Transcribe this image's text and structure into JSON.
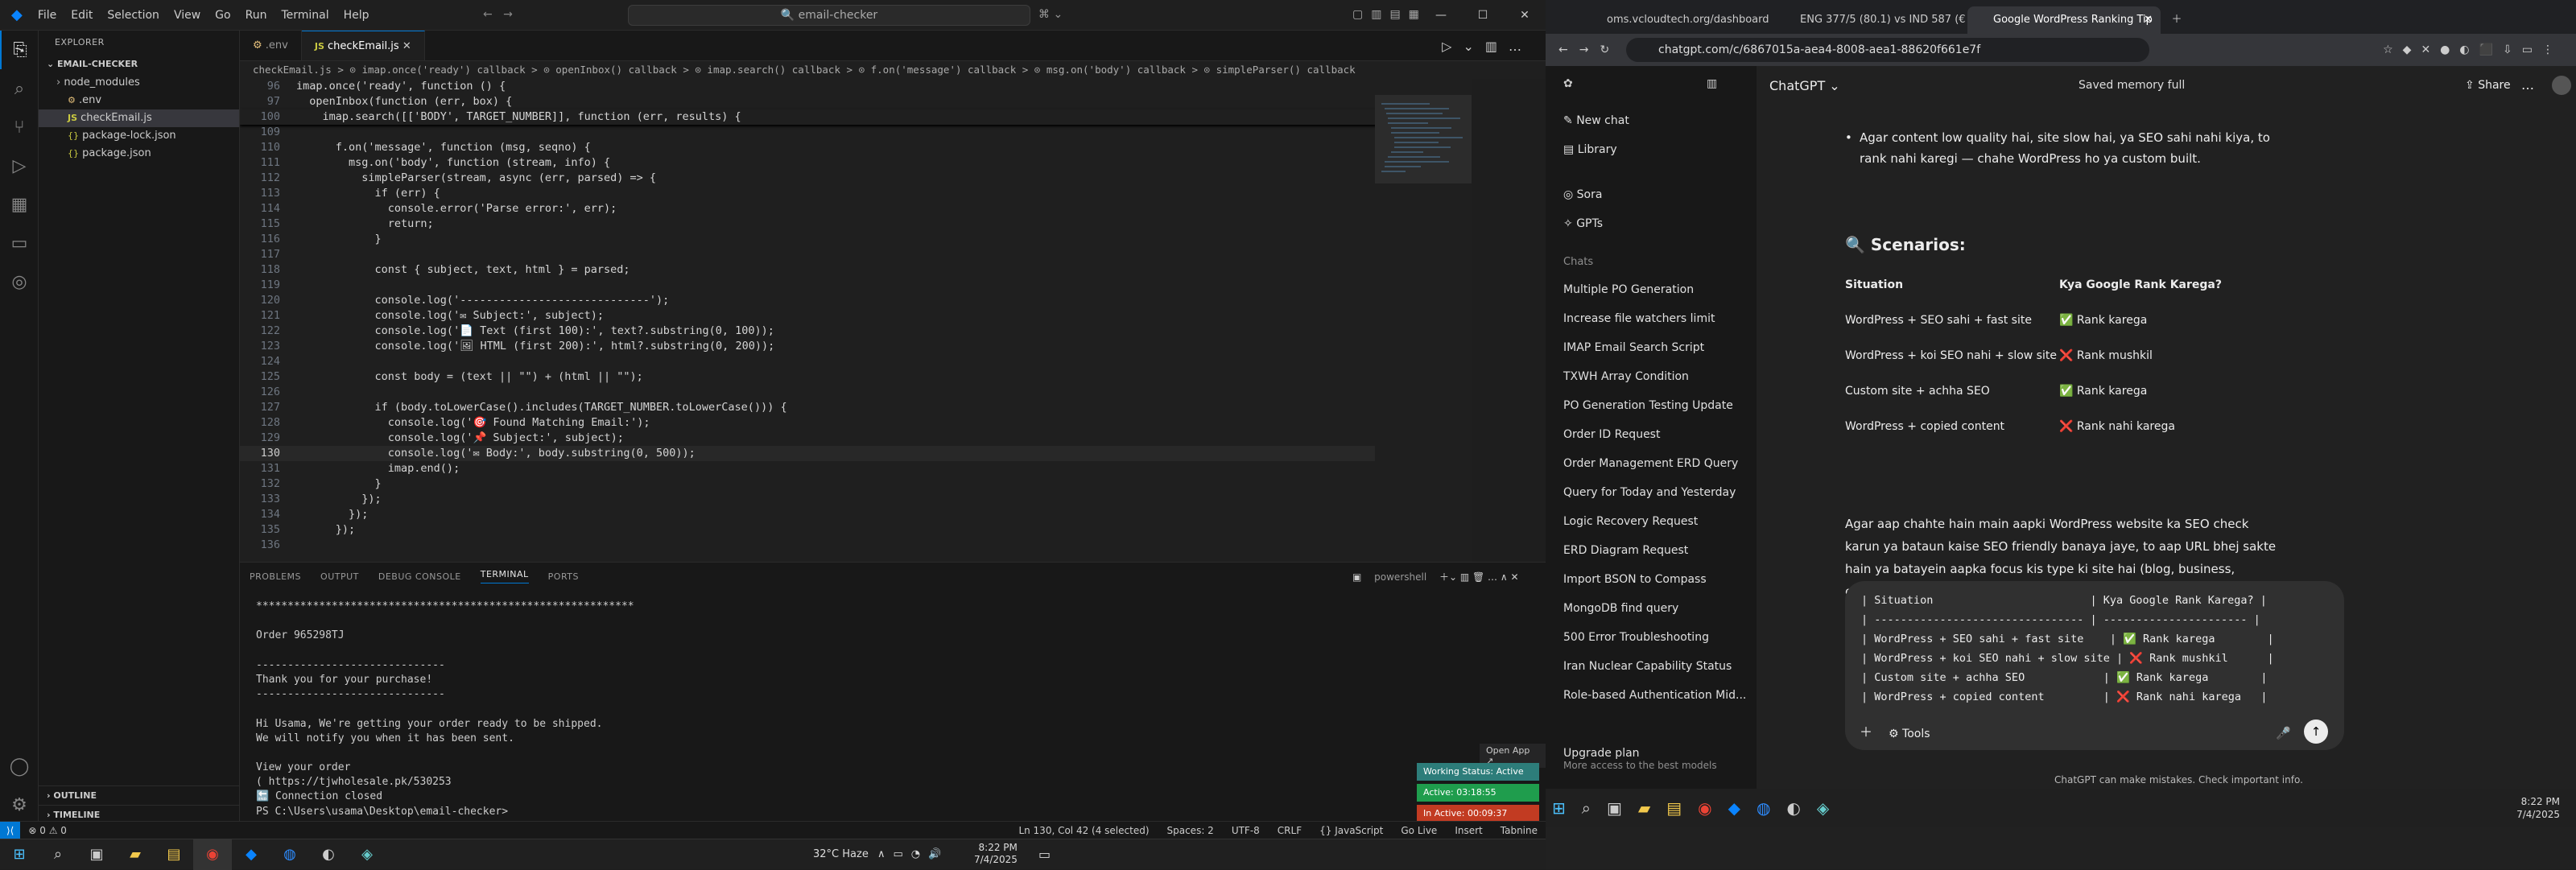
{
  "vscode": {
    "menu": [
      "File",
      "Edit",
      "Selection",
      "View",
      "Go",
      "Run",
      "Terminal",
      "Help"
    ],
    "command_center": "email-checker",
    "tabs": [
      ".env",
      "checkEmail.js"
    ],
    "breadcrumbs": "checkEmail.js > ⊙ imap.once('ready') callback > ⊙ openInbox() callback > ⊙ imap.search() callback > ⊙ f.on('message') callback > ⊙ msg.on('body') callback > ⊙ simpleParser() callback",
    "explorer": {
      "title": "EXPLORER",
      "folder": "EMAIL-CHECKER",
      "items": [
        "node_modules",
        ".env",
        "checkEmail.js",
        "package-lock.json",
        "package.json"
      ],
      "outline": "OUTLINE",
      "timeline": "TIMELINE"
    },
    "sticky_lines": [
      {
        "n": "96",
        "t": "imap.once('ready', function () {"
      },
      {
        "n": "97",
        "t": "  openInbox(function (err, box) {"
      },
      {
        "n": "100",
        "t": "    imap.search([['BODY', TARGET_NUMBER]], function (err, results) {"
      }
    ],
    "code_lines": [
      {
        "n": "109",
        "t": ""
      },
      {
        "n": "110",
        "t": "      f.on('message', function (msg, seqno) {"
      },
      {
        "n": "111",
        "t": "        msg.on('body', function (stream, info) {"
      },
      {
        "n": "112",
        "t": "          simpleParser(stream, async (err, parsed) => {"
      },
      {
        "n": "113",
        "t": "            if (err) {"
      },
      {
        "n": "114",
        "t": "              console.error('Parse error:', err);"
      },
      {
        "n": "115",
        "t": "              return;"
      },
      {
        "n": "116",
        "t": "            }"
      },
      {
        "n": "117",
        "t": ""
      },
      {
        "n": "118",
        "t": "            const { subject, text, html } = parsed;"
      },
      {
        "n": "119",
        "t": ""
      },
      {
        "n": "120",
        "t": "            console.log('-----------------------------');"
      },
      {
        "n": "121",
        "t": "            console.log('✉ Subject:', subject);"
      },
      {
        "n": "122",
        "t": "            console.log('📄 Text (first 100):', text?.substring(0, 100));"
      },
      {
        "n": "123",
        "t": "            console.log('🖼 HTML (first 200):', html?.substring(0, 200));"
      },
      {
        "n": "124",
        "t": ""
      },
      {
        "n": "125",
        "t": "            const body = (text || \"\") + (html || \"\");"
      },
      {
        "n": "126",
        "t": ""
      },
      {
        "n": "127",
        "t": "            if (body.toLowerCase().includes(TARGET_NUMBER.toLowerCase())) {"
      },
      {
        "n": "128",
        "t": "              console.log('🎯 Found Matching Email:');"
      },
      {
        "n": "129",
        "t": "              console.log('📌 Subject:', subject);"
      },
      {
        "n": "130",
        "t": "              console.log('✉ Body:', body.substring(0, 500));"
      },
      {
        "n": "131",
        "t": "              imap.end();"
      },
      {
        "n": "132",
        "t": "            }"
      },
      {
        "n": "133",
        "t": "          });"
      },
      {
        "n": "134",
        "t": "        });"
      },
      {
        "n": "135",
        "t": "      });"
      },
      {
        "n": "136",
        "t": ""
      }
    ],
    "panel_tabs": [
      "PROBLEMS",
      "OUTPUT",
      "DEBUG CONSOLE",
      "TERMINAL",
      "PORTS"
    ],
    "terminal_name": "powershell",
    "terminal_lines": [
      "************************************************************",
      "",
      "Order 965298TJ",
      "",
      "------------------------------",
      "Thank you for your purchase!",
      "------------------------------",
      "",
      "Hi Usama, We're getting your order ready to be shipped.",
      "We will notify you when it has been sent.",
      "",
      "View your order",
      "( https://tjwholesale.pk/530253",
      "🔚 Connection closed",
      "PS C:\\Users\\usama\\Desktop\\email-checker> "
    ],
    "open_app": "Open App ↗",
    "toasts": [
      "Working Status: Active",
      "Active: 03:18:55",
      "In Active: 00:09:37"
    ],
    "status_left": "⊗ 0 ⚠ 0",
    "status_right": [
      "Ln 130, Col 42 (4 selected)",
      "Spaces: 2",
      "UTF-8",
      "CRLF",
      "{} JavaScript",
      "Go Live",
      "Insert",
      "Tabnine"
    ],
    "weather": "32°C Haze",
    "clock_time": "8:22 PM",
    "clock_date": "7/4/2025"
  },
  "chrome": {
    "tabs": [
      "oms.vcloudtech.org/dashboard",
      "ENG 377/5 (80.1) vs IND 587 (€",
      "Google WordPress Ranking Tip"
    ],
    "url": "chatgpt.com/c/6867015a-aea4-8008-aea1-88620f661e7f",
    "sidebar": {
      "new_chat": "New chat",
      "library": "Library",
      "sora": "Sora",
      "gpts": "GPTs",
      "chats_label": "Chats",
      "chats": [
        "Multiple PO Generation",
        "Increase file watchers limit",
        "IMAP Email Search Script",
        "TXWH Array Condition",
        "PO Generation Testing Update",
        "Order ID Request",
        "Order Management ERD Query",
        "Query for Today and Yesterday",
        "Logic Recovery Request",
        "ERD Diagram Request",
        "Import BSON to Compass",
        "MongoDB find query",
        "500 Error Troubleshooting",
        "Iran Nuclear Capability Status",
        "Role-based Authentication Mid..."
      ],
      "upgrade": "Upgrade plan",
      "upgrade_sub": "More access to the best models"
    },
    "header": {
      "model": "ChatGPT ⌄",
      "memory": "Saved memory full",
      "share": "Share"
    },
    "bullet": "Agar content low quality hai, site slow hai, ya SEO sahi nahi kiya, to rank nahi karegi — chahe WordPress ho ya custom built.",
    "scenarios_title": "🔍 Scenarios:",
    "table_headers": [
      "Situation",
      "Kya Google Rank Karega?"
    ],
    "table_rows": [
      [
        "WordPress + SEO sahi + fast site",
        "✅ Rank karega"
      ],
      [
        "WordPress + koi SEO nahi + slow site",
        "❌ Rank mushkil"
      ],
      [
        "Custom site + achha SEO",
        "✅ Rank karega"
      ],
      [
        "WordPress + copied content",
        "❌ Rank nahi karega"
      ]
    ],
    "para": "Agar aap chahte hain main aapki WordPress website ka SEO check karun ya bataun kaise SEO friendly banaya jaye, to aap URL bhej sakte hain ya batayein aapka focus kis type ki site hai (blog, business, ecommerce etc.).",
    "composer_lines": [
      "| Situation                        | Kya Google Rank Karega? |",
      "| -------------------------------- | ---------------------- |",
      "| WordPress + SEO sahi + fast site    | ✅ Rank karega        |",
      "| WordPress + koi SEO nahi + slow site | ❌ Rank mushkil      |",
      "| Custom site + achha SEO            | ✅ Rank karega        |",
      "| WordPress + copied content         | ❌ Rank nahi karega   |"
    ],
    "tools": "Tools",
    "disclaimer": "ChatGPT can make mistakes. Check important info.",
    "clock_time": "8:22 PM",
    "clock_date": "7/4/2025"
  }
}
